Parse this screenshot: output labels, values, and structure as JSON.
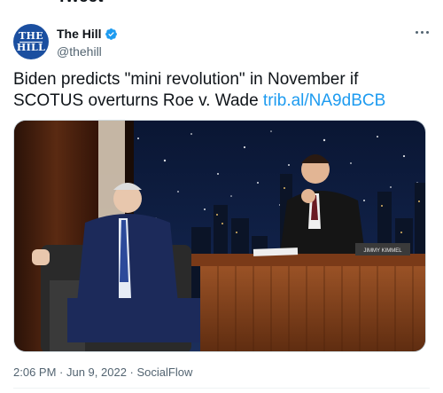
{
  "header": {
    "title": "Tweet"
  },
  "author": {
    "display_name": "The Hill",
    "handle": "@thehill",
    "avatar_text_top": "THE",
    "avatar_text_bottom": "HILL",
    "avatar_color": "#1b4fa0"
  },
  "tweet": {
    "text": "Biden predicts \"mini revolution\" in November if SCOTUS overturns Roe v. Wade ",
    "link": "trib.al/NA9dBCB"
  },
  "media": {
    "nameplate": "JIMMY KIMMEL"
  },
  "meta": {
    "time": "2:06 PM",
    "sep1": " · ",
    "date": "Jun 9, 2022",
    "sep2": " · ",
    "source": "SocialFlow"
  },
  "colors": {
    "link": "#1d9bf0",
    "verified": "#1d9bf0",
    "muted": "#536471"
  }
}
